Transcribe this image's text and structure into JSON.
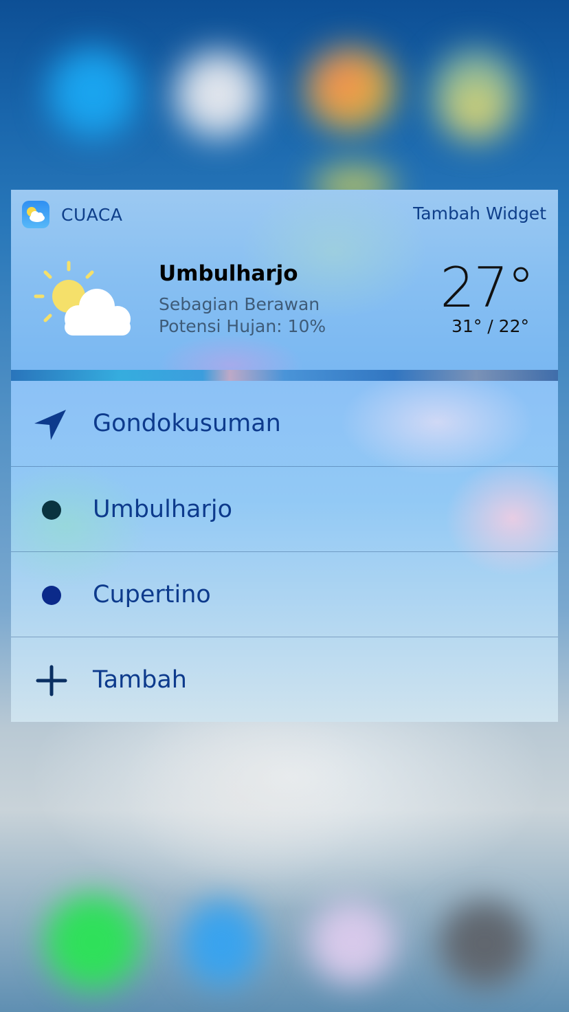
{
  "widget": {
    "app_name": "CUACA",
    "add_widget": "Tambah Widget",
    "location": "Umbulharjo",
    "condition": "Sebagian Berawan",
    "rain_chance": "Potensi Hujan: 10%",
    "temperature": "27°",
    "high_low": "31° / 22°",
    "icon": "partly-cloudy-icon"
  },
  "menu": {
    "items": [
      {
        "label": "Gondokusuman",
        "icon": "location-arrow-icon"
      },
      {
        "label": "Umbulharjo",
        "icon": "dot-icon",
        "color": "#0a3340"
      },
      {
        "label": "Cupertino",
        "icon": "dot-icon",
        "color": "#0b2a8a"
      },
      {
        "label": "Tambah",
        "icon": "plus-icon"
      }
    ]
  },
  "colors": {
    "accent": "#0d3a8c",
    "widget_background": "#87bff2"
  }
}
